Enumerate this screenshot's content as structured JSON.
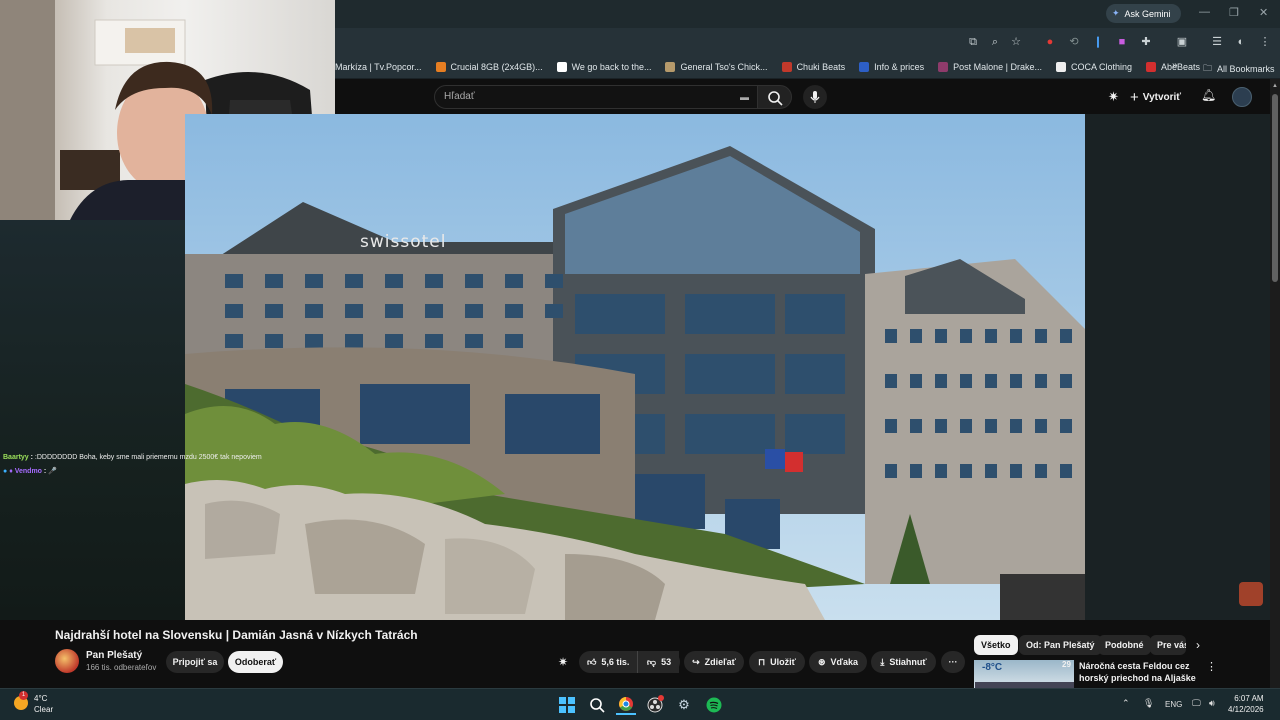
{
  "browser": {
    "gemini_label": "Ask Gemini",
    "bookmarks": [
      {
        "label": "Markíza | Tv.Popcor...",
        "color": "#3b4a52"
      },
      {
        "label": "Crucial 8GB (2x4GB)...",
        "color": "#e67e22"
      },
      {
        "label": "We go back to the...",
        "color": "#ffffff"
      },
      {
        "label": "General Tso's Chick...",
        "color": "#b59a6b"
      },
      {
        "label": "Chuki Beats",
        "color": "#c0392b"
      },
      {
        "label": "Info & prices",
        "color": "#2d5fc6"
      },
      {
        "label": "Post Malone | Drake...",
        "color": "#8e3b6b"
      },
      {
        "label": "COCA Clothing",
        "color": "#eeeeee"
      },
      {
        "label": "AbeBeats",
        "color": "#d32f2f"
      }
    ],
    "all_bookmarks": "All Bookmarks"
  },
  "youtube": {
    "search_placeholder": "Hľadať",
    "create_label": "Vytvoriť"
  },
  "chat": [
    {
      "user": "Baartyy",
      "user_color": "#9be05a",
      "message": ":DDDDDDDD Boha, keby sme mali priemernu mzdu 2500€ tak nepoviem"
    },
    {
      "user": "Vendmo",
      "user_color": "#a66bff",
      "message": "🎤"
    }
  ],
  "video": {
    "hotel_sign": "swissotel",
    "title": "Najdrahší hotel na Slovensku | Damián Jasná v Nízkych Tatrách",
    "channel": "Pan Plešatý",
    "subscribers": "166 tis. odberateľov",
    "join_label": "Pripojiť sa",
    "subscribe_label": "Odoberať",
    "likes": "5,6 tis.",
    "dislikes": "53",
    "share_label": "Zdieľať",
    "save_label": "Uložiť",
    "thanks_label": "Vďaka",
    "download_label": "Stiahnuť"
  },
  "sidebar": {
    "chips": [
      "Všetko",
      "Od: Pan Plešatý",
      "Podobné",
      "Pre vás"
    ],
    "recommendation": {
      "title": "Náročná cesta Feldou cez horský priechod na Aljaške na ...",
      "thumb_text": "-8°C",
      "thumb_badge": "29"
    }
  },
  "taskbar": {
    "temperature": "4°C",
    "weather": "Clear",
    "badge_count": "1",
    "language": "ENG",
    "time": "6:07 AM",
    "date": "4/12/2026"
  }
}
